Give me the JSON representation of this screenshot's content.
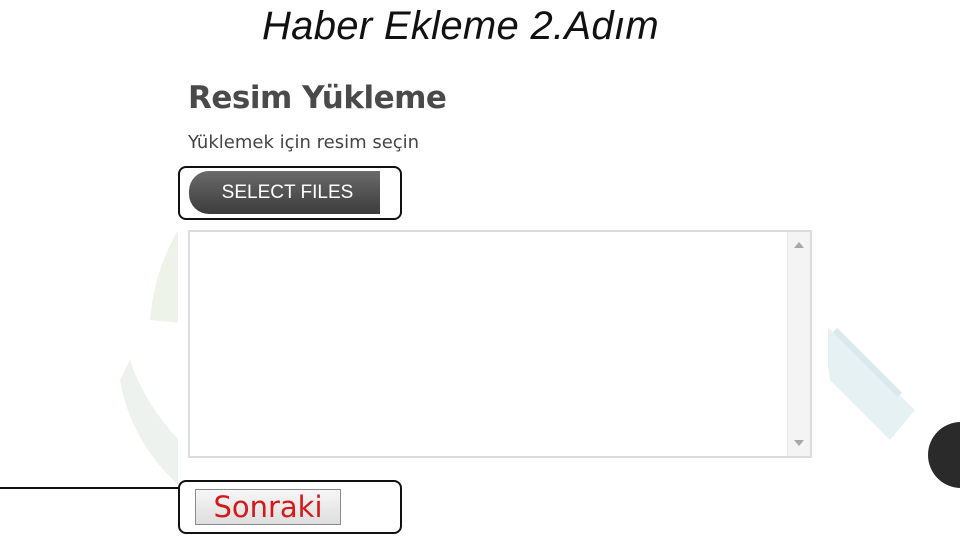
{
  "slide": {
    "title": "Haber Ekleme 2.Adım"
  },
  "upload": {
    "heading": "Resim Yükleme",
    "instruction": "Yüklemek için resim seçin",
    "select_button_label": "SELECT FILES",
    "textarea_value": ""
  },
  "navigation": {
    "next_button_label": "Sonraki"
  },
  "colors": {
    "select_button": "#4d4d4d",
    "next_button_text": "#d21a1a",
    "highlight_border": "#111111"
  }
}
